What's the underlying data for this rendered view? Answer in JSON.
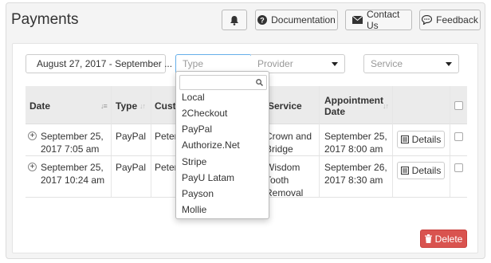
{
  "header": {
    "title": "Payments",
    "documentation_label": "Documentation",
    "contact_label": "Contact Us",
    "feedback_label": "Feedback"
  },
  "filters": {
    "date_range": "August 27, 2017 - September ...",
    "type_placeholder": "Type",
    "provider_placeholder": "Provider",
    "service_placeholder": "Service"
  },
  "table": {
    "columns": [
      "Date",
      "Type",
      "Custo",
      "Service",
      "Appointment Date"
    ],
    "rows": [
      {
        "date": "September 25, 2017 7:05 am",
        "type": "PayPal",
        "customer": "Peter",
        "service": "Crown and Bridge",
        "appointment_date": "September 25, 2017 8:00 am",
        "details_label": "Details"
      },
      {
        "date": "September 25, 2017 10:24 am",
        "type": "PayPal",
        "customer": "Peter",
        "service": "Wisdom Tooth Removal",
        "appointment_date": "September 26, 2017 8:30 am",
        "details_label": "Details"
      }
    ]
  },
  "type_dropdown": {
    "options": [
      "Local",
      "2Checkout",
      "PayPal",
      "Authorize.Net",
      "Stripe",
      "PayU Latam",
      "Payson",
      "Mollie"
    ]
  },
  "footer": {
    "delete_label": "Delete"
  },
  "colors": {
    "delete": "#d9534f",
    "header_bg": "#ebebeb",
    "panel_bg": "#f4f4f4"
  }
}
